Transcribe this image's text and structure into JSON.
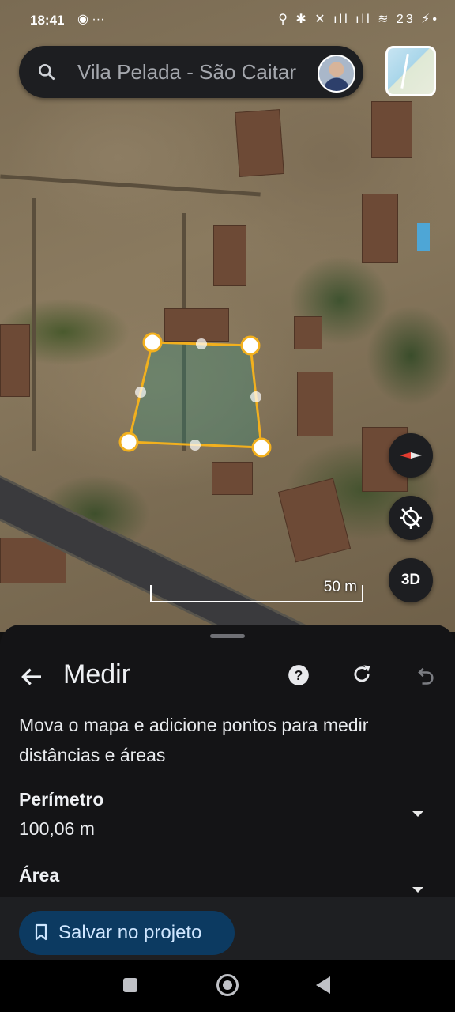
{
  "status_bar": {
    "time": "18:41",
    "left_icons": "◉ ···",
    "right_icons": "⚲ ✱ ✕ ıll ıll ≋ 23 ⚡•",
    "battery_level": "23"
  },
  "search": {
    "text": "Vila Pelada - São Caitar",
    "search_icon": "search-icon",
    "avatar": "user-avatar"
  },
  "map": {
    "layer_button": "layers-thumbnail",
    "scale_label": "50 m",
    "three_d_label": "3D",
    "compass_icon": "compass-icon",
    "location_icon": "location-off-icon",
    "measure_color": "#f2b01e"
  },
  "sheet": {
    "title": "Medir",
    "instructions": "Mova o mapa e adicione pontos para medir distâncias e áreas",
    "perimeter_label": "Perímetro",
    "perimeter_value": "100,06 m",
    "area_label": "Área",
    "back_icon": "arrow-back-icon",
    "help_icon": "help-icon",
    "reset_icon": "refresh-icon",
    "undo_icon": "undo-icon"
  },
  "save": {
    "label": "Salvar no projeto",
    "icon": "bookmark-icon",
    "bg_color": "#0c3a61"
  },
  "nav_bar": {
    "recents": "recents-icon",
    "home": "home-icon",
    "back": "back-icon"
  }
}
